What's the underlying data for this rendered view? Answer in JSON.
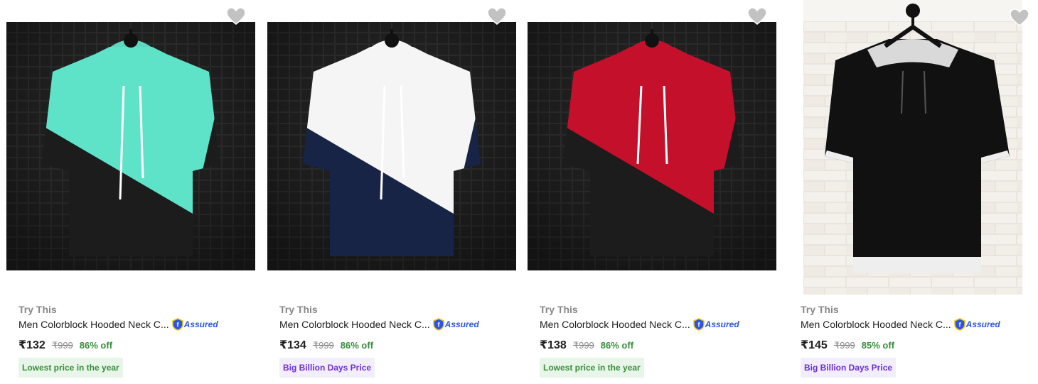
{
  "products": [
    {
      "brand": "Try This",
      "title": "Men Colorblock Hooded Neck C...",
      "assured": "Assured",
      "price": "₹132",
      "mrp": "₹999",
      "discount": "86% off",
      "tag": "Lowest price in the year",
      "tag_style": "green",
      "colors": {
        "top": "#5fe3c8",
        "bottom": "#1c1c1c",
        "background": "grid"
      }
    },
    {
      "brand": "Try This",
      "title": "Men Colorblock Hooded Neck C...",
      "assured": "Assured",
      "price": "₹134",
      "mrp": "₹999",
      "discount": "86% off",
      "tag": "Big Billion Days Price",
      "tag_style": "purple",
      "colors": {
        "top": "#f5f5f5",
        "bottom": "#172445",
        "background": "grid"
      }
    },
    {
      "brand": "Try This",
      "title": "Men Colorblock Hooded Neck C...",
      "assured": "Assured",
      "price": "₹138",
      "mrp": "₹999",
      "discount": "86% off",
      "tag": "Lowest price in the year",
      "tag_style": "green",
      "colors": {
        "top": "#c4102a",
        "bottom": "#1c1c1c",
        "background": "grid"
      }
    },
    {
      "brand": "Try This",
      "title": "Men Colorblock Hooded Neck C...",
      "assured": "Assured",
      "price": "₹145",
      "mrp": "₹999",
      "discount": "85% off",
      "tag": "Big Billion Days Price",
      "tag_style": "purple",
      "colors": {
        "top": "#111111",
        "bottom": "#111111",
        "background": "brick"
      }
    }
  ],
  "icons": {
    "wishlist": "heart-icon",
    "assured": "shield-icon"
  }
}
